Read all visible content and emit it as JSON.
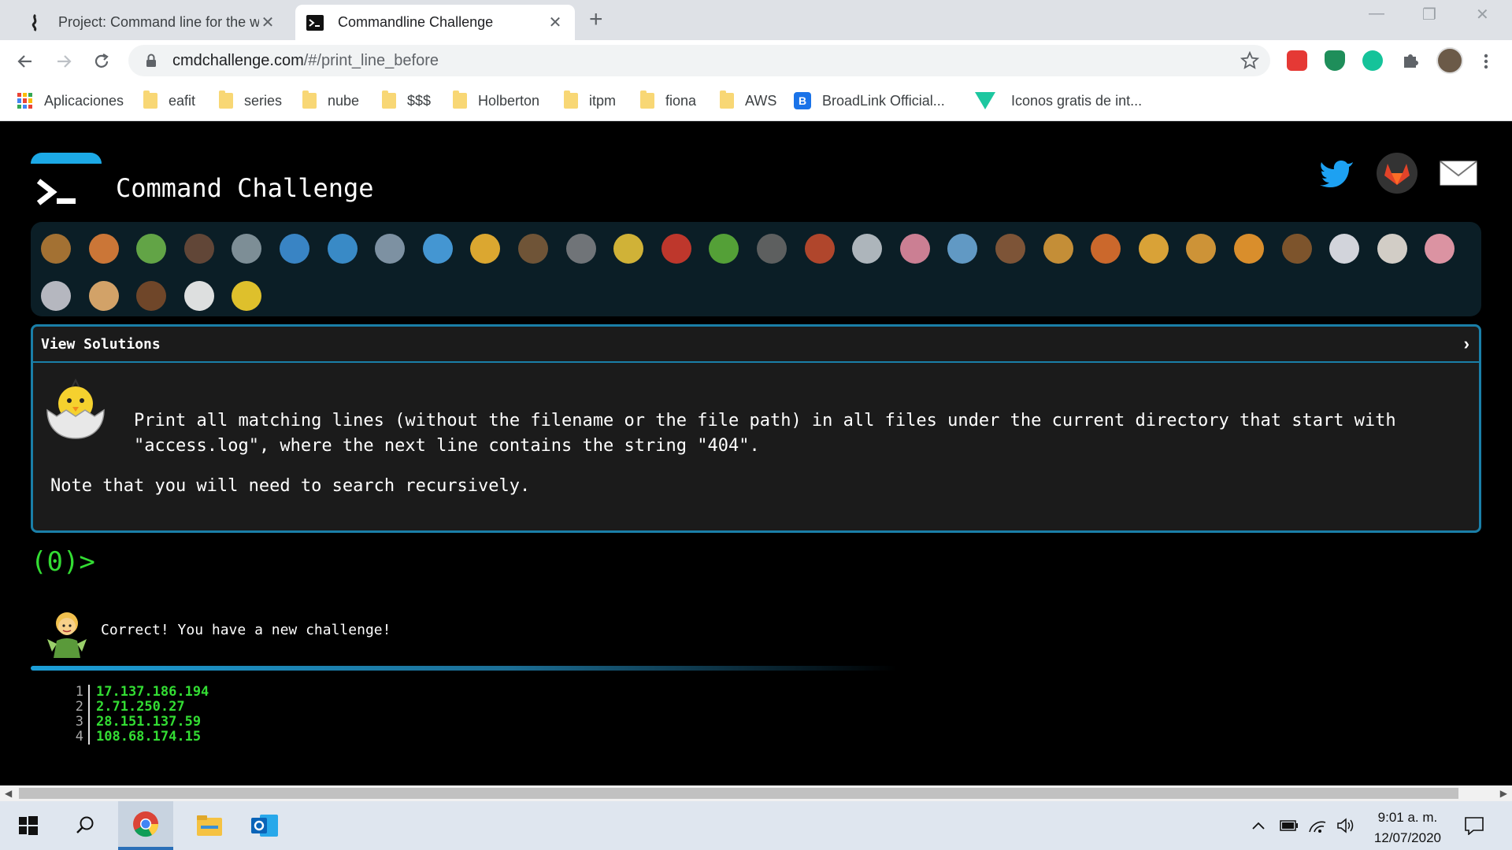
{
  "browser": {
    "tabs": [
      {
        "title": "Project: Command line for the wi",
        "active": false
      },
      {
        "title": "Commandline Challenge",
        "active": true
      }
    ],
    "url": {
      "host": "cmdchallenge.com",
      "path": "/#/print_line_before"
    },
    "bookmarks": [
      "Aplicaciones",
      "eafit",
      "series",
      "nube",
      "$$$",
      "Holberton",
      "itpm",
      "fiona",
      "AWS",
      "BroadLink Official...",
      "Iconos gratis de int..."
    ]
  },
  "site": {
    "title": "Command Challenge",
    "social": [
      "twitter-icon",
      "gitlab-icon",
      "mail-icon"
    ]
  },
  "challenge_icons": [
    {
      "name": "snail",
      "color": "#b47a35"
    },
    {
      "name": "butterfly",
      "color": "#e0803a"
    },
    {
      "name": "caterpillar",
      "color": "#6bb34a"
    },
    {
      "name": "ant",
      "color": "#6a4a3a"
    },
    {
      "name": "spider-web",
      "color": "#8a9aa3"
    },
    {
      "name": "whale",
      "color": "#3e8fd6"
    },
    {
      "name": "dolphin",
      "color": "#3e96d8"
    },
    {
      "name": "shark",
      "color": "#8a9db0"
    },
    {
      "name": "fish",
      "color": "#4aa3e6"
    },
    {
      "name": "tropical-fish",
      "color": "#f2b632"
    },
    {
      "name": "crab-turtle",
      "color": "#7a5a3a"
    },
    {
      "name": "wolf",
      "color": "#7b7d82"
    },
    {
      "name": "bee",
      "color": "#e6c23a"
    },
    {
      "name": "ladybug",
      "color": "#d23a2e"
    },
    {
      "name": "lizard",
      "color": "#5cae3a"
    },
    {
      "name": "spider",
      "color": "#666666"
    },
    {
      "name": "scorpion",
      "color": "#c24a2e"
    },
    {
      "name": "fly",
      "color": "#bfc5cc"
    },
    {
      "name": "worm",
      "color": "#e08aa0"
    },
    {
      "name": "microbe",
      "color": "#6aa6d6"
    },
    {
      "name": "monkey",
      "color": "#8a5a3a"
    },
    {
      "name": "dog",
      "color": "#d89a3a"
    },
    {
      "name": "fox",
      "color": "#e0702e"
    },
    {
      "name": "cat",
      "color": "#f0b03a"
    },
    {
      "name": "lion",
      "color": "#e2a03a"
    },
    {
      "name": "tiger",
      "color": "#f09a2e"
    },
    {
      "name": "horse",
      "color": "#8a5a2e"
    },
    {
      "name": "unicorn",
      "color": "#e8e8f0"
    },
    {
      "name": "cow",
      "color": "#e8e0d8"
    },
    {
      "name": "pig",
      "color": "#f2a0b0"
    },
    {
      "name": "mouse",
      "color": "#c8c8d0"
    },
    {
      "name": "hamster",
      "color": "#e8b070"
    },
    {
      "name": "bear",
      "color": "#7a4a2a"
    },
    {
      "name": "panda",
      "color": "#f4f4f4"
    },
    {
      "name": "hatching-chick",
      "color": "#f5d12e"
    }
  ],
  "panel": {
    "header": "View Solutions",
    "description": "Print all matching lines (without the filename or the file path) in all files under the current directory that start with \"access.log\", where the next line contains the string \"404\".",
    "note": "Note that you will need to search recursively."
  },
  "prompt": "(0)>",
  "result_message": "Correct! You have a new challenge!",
  "output": [
    {
      "n": "1",
      "text": "17.137.186.194"
    },
    {
      "n": "2",
      "text": "2.71.250.27"
    },
    {
      "n": "3",
      "text": "28.151.137.59"
    },
    {
      "n": "4",
      "text": "108.68.174.15"
    }
  ],
  "taskbar": {
    "time": "9:01 a. m.",
    "date": "12/07/2020"
  }
}
